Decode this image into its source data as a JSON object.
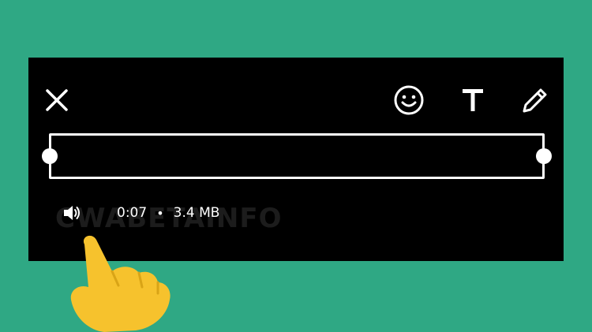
{
  "toolbar": {
    "close_icon": "close-icon",
    "emoji_icon": "emoji-icon",
    "text_icon": "text-icon",
    "pen_icon": "pen-icon"
  },
  "audio": {
    "speaker_icon": "speaker-icon",
    "duration": "0:07",
    "separator": "•",
    "size": "3.4 MB"
  },
  "watermark": "CWABETAINFO",
  "colors": {
    "background": "#2fa884",
    "panel": "#000000",
    "foreground": "#ffffff",
    "hand": "#f6c22d"
  }
}
